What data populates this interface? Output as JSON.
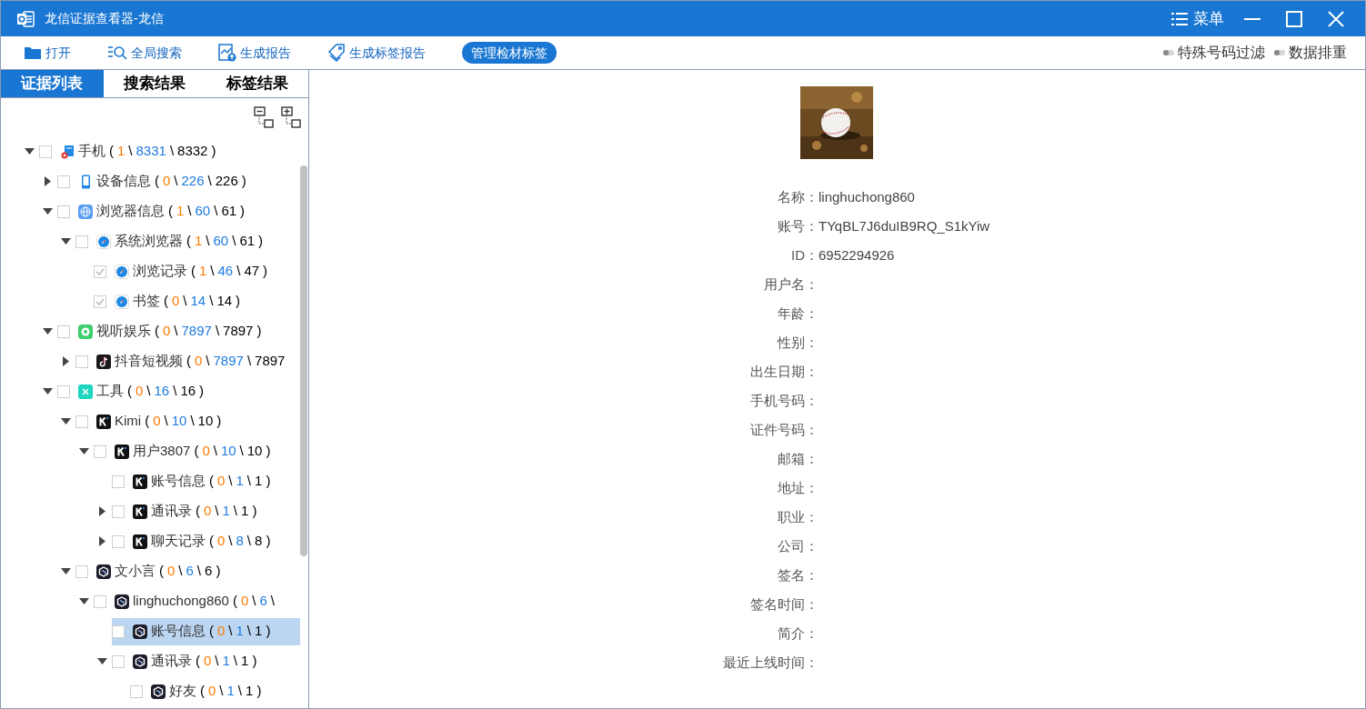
{
  "window": {
    "title": "龙信证据查看器-龙信",
    "menu_label": "菜单"
  },
  "toolbar": [
    {
      "kind": "open",
      "label": "打开",
      "selected": false
    },
    {
      "kind": "search",
      "label": "全局搜索",
      "selected": false
    },
    {
      "kind": "report",
      "label": "生成报告",
      "selected": false
    },
    {
      "kind": "tag",
      "label": "生成标签报告",
      "selected": false
    },
    {
      "kind": "plain",
      "label": "管理检材标签",
      "selected": true
    }
  ],
  "toggles": [
    {
      "label": "特殊号码过滤",
      "on": false
    },
    {
      "label": "数据排重",
      "on": false
    }
  ],
  "tabs": [
    {
      "label": "证据列表",
      "selected": true
    },
    {
      "label": "搜索结果",
      "selected": false
    },
    {
      "label": "标签结果",
      "selected": false
    }
  ],
  "tree": [
    {
      "kind": "phone",
      "label": "手机",
      "counts": [
        "(",
        "1",
        "\\",
        "8331",
        "\\",
        "8332",
        ")"
      ],
      "expanded": true,
      "checked": false,
      "selected": false,
      "children": [
        {
          "kind": "device",
          "label": "设备信息",
          "counts": [
            "(",
            "0",
            "\\",
            "226",
            "\\",
            "226",
            ")"
          ],
          "expanded": false,
          "checked": false,
          "selected": false
        },
        {
          "kind": "globe",
          "label": "浏览器信息",
          "counts": [
            "(",
            "1",
            "\\",
            "60",
            "\\",
            "61",
            ")"
          ],
          "expanded": true,
          "checked": false,
          "selected": false,
          "children": [
            {
              "kind": "compass",
              "label": "系统浏览器",
              "counts": [
                "(",
                "1",
                "\\",
                "60",
                "\\",
                "61",
                ")"
              ],
              "expanded": true,
              "checked": false,
              "selected": false,
              "children": [
                {
                  "kind": "compass",
                  "label": "浏览记录",
                  "counts": [
                    "(",
                    "1",
                    "\\",
                    "46",
                    "\\",
                    "47",
                    ")"
                  ],
                  "checked": true,
                  "selected": false
                },
                {
                  "kind": "compass",
                  "label": "书签",
                  "counts": [
                    "(",
                    "0",
                    "\\",
                    "14",
                    "\\",
                    "14",
                    ")"
                  ],
                  "checked": true,
                  "selected": false
                }
              ]
            }
          ]
        },
        {
          "kind": "media",
          "label": "视听娱乐",
          "counts": [
            "(",
            "0",
            "\\",
            "7897",
            "\\",
            "7897",
            ")"
          ],
          "expanded": true,
          "checked": false,
          "selected": false,
          "children": [
            {
              "kind": "note",
              "label": "抖音短视频",
              "counts": [
                "(",
                "0",
                "\\",
                "7897",
                "\\",
                "7897"
              ],
              "expanded": false,
              "checked": false,
              "selected": false
            }
          ]
        },
        {
          "kind": "tools",
          "label": "工具",
          "counts": [
            "(",
            "0",
            "\\",
            "16",
            "\\",
            "16",
            ")"
          ],
          "expanded": true,
          "checked": false,
          "selected": false,
          "children": [
            {
              "kind": "kimi",
              "label": "Kimi",
              "counts": [
                "(",
                "0",
                "\\",
                "10",
                "\\",
                "10",
                ")"
              ],
              "expanded": true,
              "checked": false,
              "selected": false,
              "children": [
                {
                  "kind": "kimi",
                  "label": "用户3807",
                  "counts": [
                    "(",
                    "0",
                    "\\",
                    "10",
                    "\\",
                    "10",
                    ")"
                  ],
                  "expanded": true,
                  "checked": false,
                  "selected": false,
                  "children": [
                    {
                      "kind": "kimi",
                      "label": "账号信息",
                      "counts": [
                        "(",
                        "0",
                        "\\",
                        "1",
                        "\\",
                        "1",
                        ")"
                      ],
                      "checked": false,
                      "selected": false
                    },
                    {
                      "kind": "kimi",
                      "label": "通讯录",
                      "counts": [
                        "(",
                        "0",
                        "\\",
                        "1",
                        "\\",
                        "1",
                        ")"
                      ],
                      "expanded": false,
                      "checked": false,
                      "selected": false
                    },
                    {
                      "kind": "kimi",
                      "label": "聊天记录",
                      "counts": [
                        "(",
                        "0",
                        "\\",
                        "8",
                        "\\",
                        "8",
                        ")"
                      ],
                      "expanded": false,
                      "checked": false,
                      "selected": false
                    }
                  ]
                }
              ]
            },
            {
              "kind": "cube",
              "label": "文小言",
              "counts": [
                "(",
                "0",
                "\\",
                "6",
                "\\",
                "6",
                ")"
              ],
              "expanded": true,
              "checked": false,
              "selected": false,
              "children": [
                {
                  "kind": "cube",
                  "label": "linghuchong860",
                  "counts": [
                    "(",
                    "0",
                    "\\",
                    "6",
                    "\\"
                  ],
                  "expanded": true,
                  "checked": false,
                  "selected": false,
                  "children": [
                    {
                      "kind": "cube",
                      "label": "账号信息",
                      "counts": [
                        "(",
                        "0",
                        "\\",
                        "1",
                        "\\",
                        "1",
                        ")"
                      ],
                      "checked": false,
                      "selected": true
                    },
                    {
                      "kind": "cube",
                      "label": "通讯录",
                      "counts": [
                        "(",
                        "0",
                        "\\",
                        "1",
                        "\\",
                        "1",
                        ")"
                      ],
                      "expanded": true,
                      "checked": false,
                      "selected": false,
                      "children": [
                        {
                          "kind": "cube",
                          "label": "好友",
                          "counts": [
                            "(",
                            "0",
                            "\\",
                            "1",
                            "\\",
                            "1",
                            ")"
                          ],
                          "checked": false,
                          "selected": false
                        }
                      ]
                    }
                  ]
                }
              ]
            }
          ]
        }
      ]
    }
  ],
  "details": {
    "fields": [
      {
        "label": "名称：",
        "value": "linghuchong860"
      },
      {
        "label": "账号：",
        "value": "TYqBL7J6duIB9RQ_S1kYiw"
      },
      {
        "label": "ID：",
        "value": "6952294926"
      },
      {
        "label": "用户名："
      },
      {
        "label": "年龄："
      },
      {
        "label": "性别："
      },
      {
        "label": "出生日期："
      },
      {
        "label": "手机号码："
      },
      {
        "label": "证件号码："
      },
      {
        "label": "邮箱："
      },
      {
        "label": "地址："
      },
      {
        "label": "职业："
      },
      {
        "label": "公司："
      },
      {
        "label": "签名："
      },
      {
        "label": "签名时间："
      },
      {
        "label": "简介："
      },
      {
        "label": "最近上线时间："
      }
    ]
  }
}
